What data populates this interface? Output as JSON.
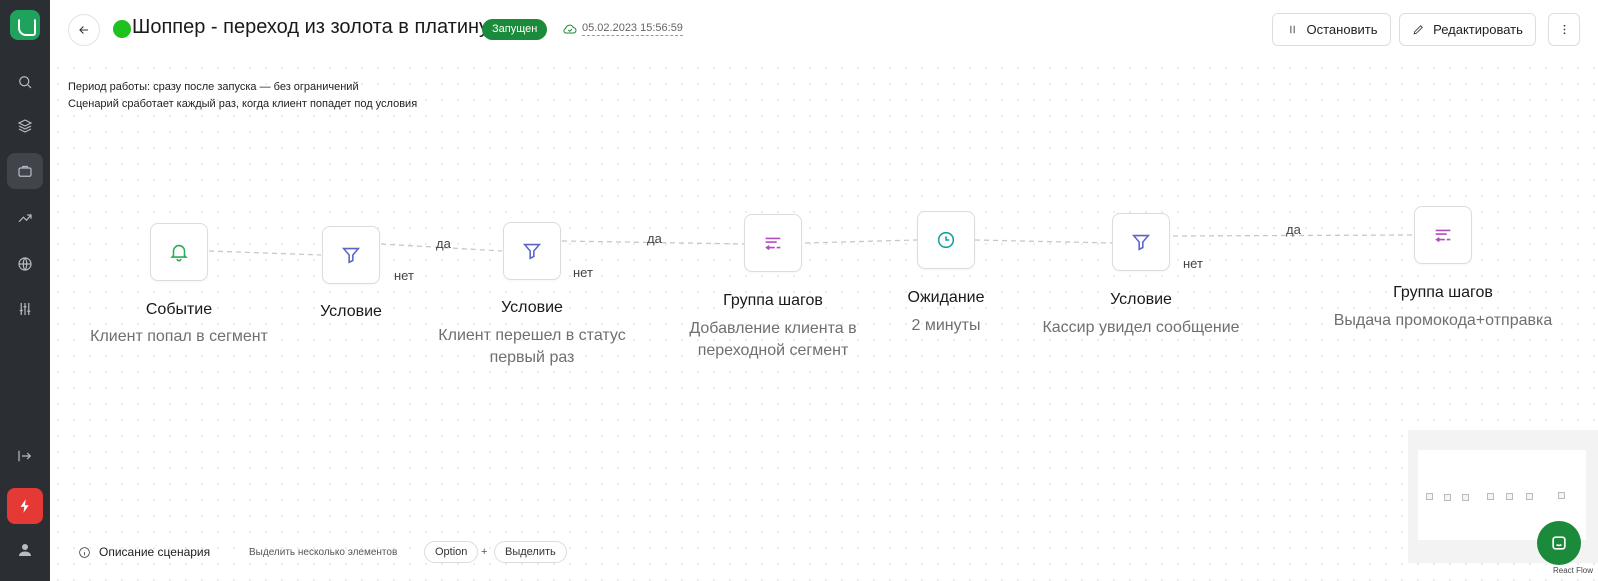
{
  "header": {
    "title": "Шоппер - переход из золота в платину",
    "status_badge": "Запущен",
    "timestamp": "05.02.2023 15:56:59",
    "stop_label": "Остановить",
    "edit_label": "Редактировать"
  },
  "info": {
    "period": "Период работы: сразу после запуска — без ограничений",
    "trigger": "Сценарий сработает каждый раз, когда клиент попадет под условия"
  },
  "nodes": {
    "event": {
      "title": "Событие",
      "subtitle": "Клиент попал в сегмент",
      "icon": "bell-icon"
    },
    "cond1": {
      "title": "Условие",
      "subtitle": "",
      "icon": "filter-icon"
    },
    "cond2": {
      "title": "Условие",
      "subtitle": "Клиент перешел в статус первый раз",
      "icon": "filter-icon"
    },
    "group1": {
      "title": "Группа шагов",
      "subtitle": "Добавление клиента в переходной сегмент",
      "icon": "step-group-icon"
    },
    "wait": {
      "title": "Ожидание",
      "subtitle": "2 минуты",
      "icon": "clock-icon"
    },
    "cond3": {
      "title": "Условие",
      "subtitle": "Кассир увидел сообщение",
      "icon": "filter-icon"
    },
    "group2": {
      "title": "Группа шагов",
      "subtitle": "Выдача промокода+отправка",
      "icon": "step-group-icon"
    }
  },
  "edge_labels": {
    "yes": "да",
    "no": "нет"
  },
  "footer": {
    "description": "Описание сценария",
    "hint": "Выделить несколько элементов",
    "key_option": "Option",
    "plus": "+",
    "key_select": "Выделить",
    "attribution": "React Flow"
  },
  "colors": {
    "brand": "#1b8a3a",
    "status_dot": "#1ec21e",
    "event_icon": "#2eaa5c",
    "filter_icon": "#5a64c8",
    "group_icon": "#b04fc0",
    "clock_icon": "#1a9fa0",
    "sidebar": "#2b2e33"
  }
}
